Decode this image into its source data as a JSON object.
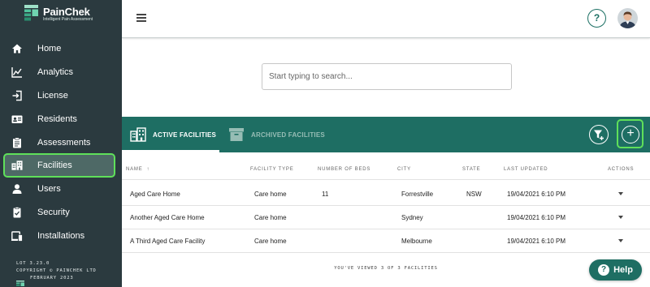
{
  "brand": {
    "name": "PainChek",
    "tagline": "Intelligent Pain Assessment",
    "primary_color": "#1e6e63",
    "sidebar_color": "#2b3a3f",
    "highlight_color": "#5fe05a"
  },
  "sidebar": {
    "items": [
      {
        "label": "Home",
        "icon": "home-icon"
      },
      {
        "label": "Analytics",
        "icon": "chart-line-icon"
      },
      {
        "label": "License",
        "icon": "sign-in-icon"
      },
      {
        "label": "Residents",
        "icon": "id-card-icon"
      },
      {
        "label": "Assessments",
        "icon": "clipboard-icon"
      },
      {
        "label": "Facilities",
        "icon": "building-icon",
        "active": true
      },
      {
        "label": "Users",
        "icon": "user-icon"
      },
      {
        "label": "Security",
        "icon": "security-clipboard-icon"
      },
      {
        "label": "Installations",
        "icon": "devices-icon"
      }
    ],
    "footer": {
      "version": "LOT 3.23.0",
      "copyright": "COPYRIGHT © PAINCHEK LTD",
      "date": "FEBRUARY 2023"
    }
  },
  "topbar": {
    "help_symbol": "?"
  },
  "search": {
    "placeholder": "Start typing to search..."
  },
  "tabs": {
    "active": "ACTIVE FACILITIES",
    "archived": "ARCHIVED FACILITIES"
  },
  "table": {
    "columns": [
      "NAME",
      "FACILITY TYPE",
      "NUMBER OF BEDS",
      "CITY",
      "STATE",
      "LAST UPDATED",
      "ACTIONS"
    ],
    "sort_indicator": "↑",
    "rows": [
      {
        "name": "Aged Care Home",
        "type": "Care home",
        "beds": "11",
        "city": "Forrestville",
        "state": "NSW",
        "updated": "19/04/2021 6:10 PM"
      },
      {
        "name": "Another Aged Care Home",
        "type": "Care home",
        "beds": "",
        "city": "Sydney",
        "state": "",
        "updated": "19/04/2021 6:10 PM"
      },
      {
        "name": "A Third Aged Care Facility",
        "type": "Care home",
        "beds": "",
        "city": "Melbourne",
        "state": "",
        "updated": "19/04/2021 6:10 PM"
      }
    ],
    "summary": "YOU'VE VIEWED 3 OF 3 FACILITIES"
  },
  "help_button": {
    "label": "Help",
    "icon": "?"
  }
}
